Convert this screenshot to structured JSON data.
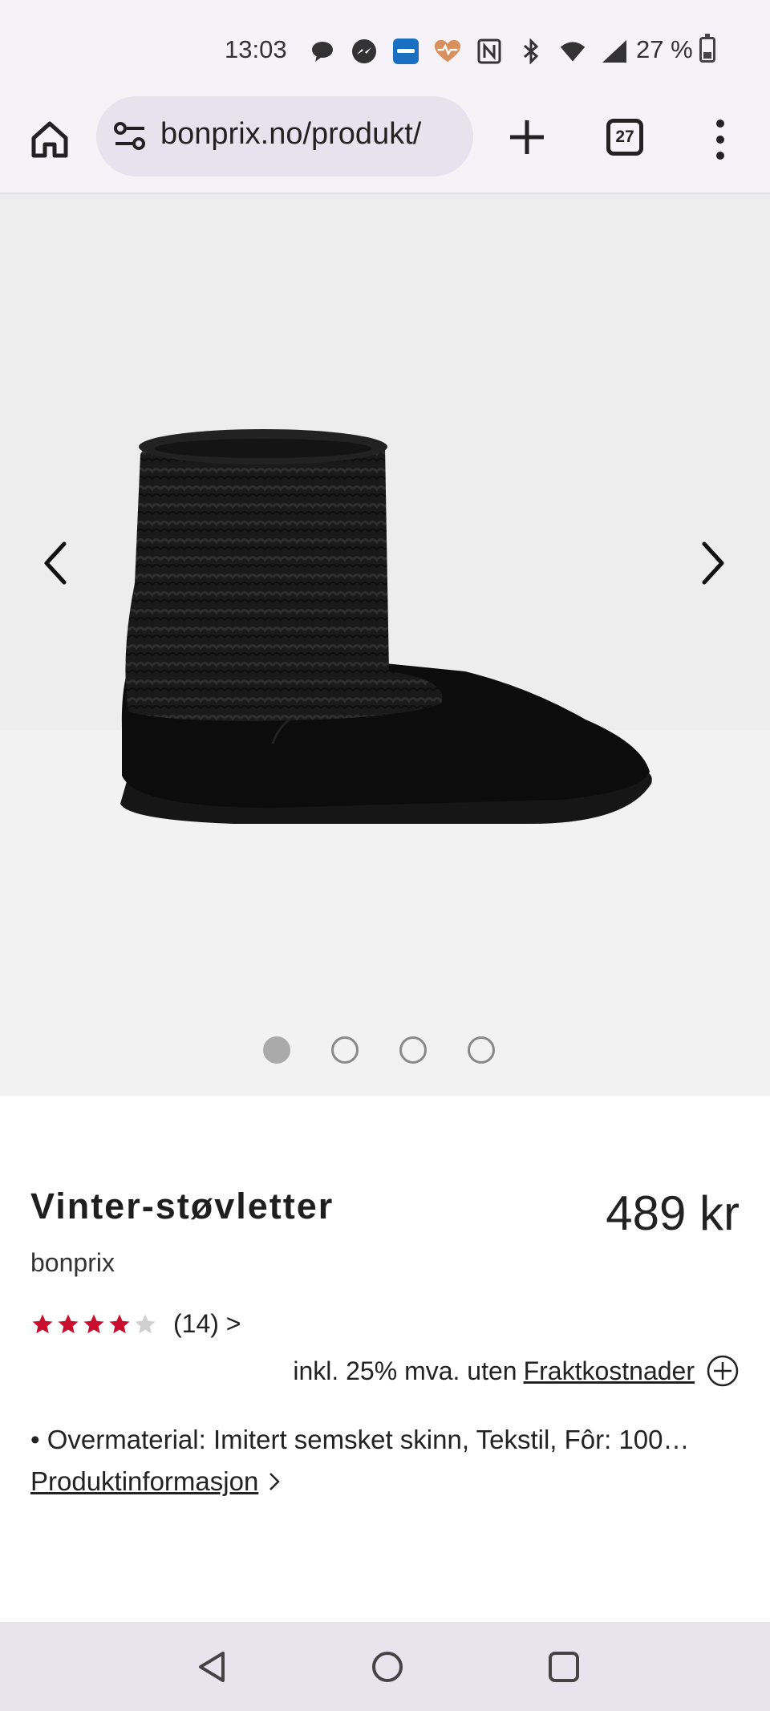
{
  "status_bar": {
    "time": "13:03",
    "battery": "27 %",
    "icons": [
      "chat-bubble-icon",
      "messenger-icon",
      "app-icon",
      "heart-rate-icon",
      "nfc-icon",
      "bluetooth-icon",
      "wifi-icon",
      "signal-icon",
      "battery-icon"
    ]
  },
  "browser": {
    "url": "bonprix.no/produkt/",
    "tab_count": "27"
  },
  "gallery": {
    "image_alt": "Black knit cuff winter boot",
    "dot_count": 4,
    "active_index": 0
  },
  "product": {
    "title": "Vinter-støvletter",
    "brand": "bonprix",
    "price": "489 kr",
    "rating_value": 4,
    "rating_max": 5,
    "rating_count": "(14) >",
    "vat_text": "inkl. 25% mva. uten",
    "shipping_link": "Fraktkostnader",
    "description": "• Overmaterial: Imitert semsket skinn, Tekstil, Fôr: 100…",
    "info_link": "Produktinformasjon"
  },
  "colors": {
    "star_filled": "#c8102e",
    "star_empty": "#cfcfcf"
  }
}
